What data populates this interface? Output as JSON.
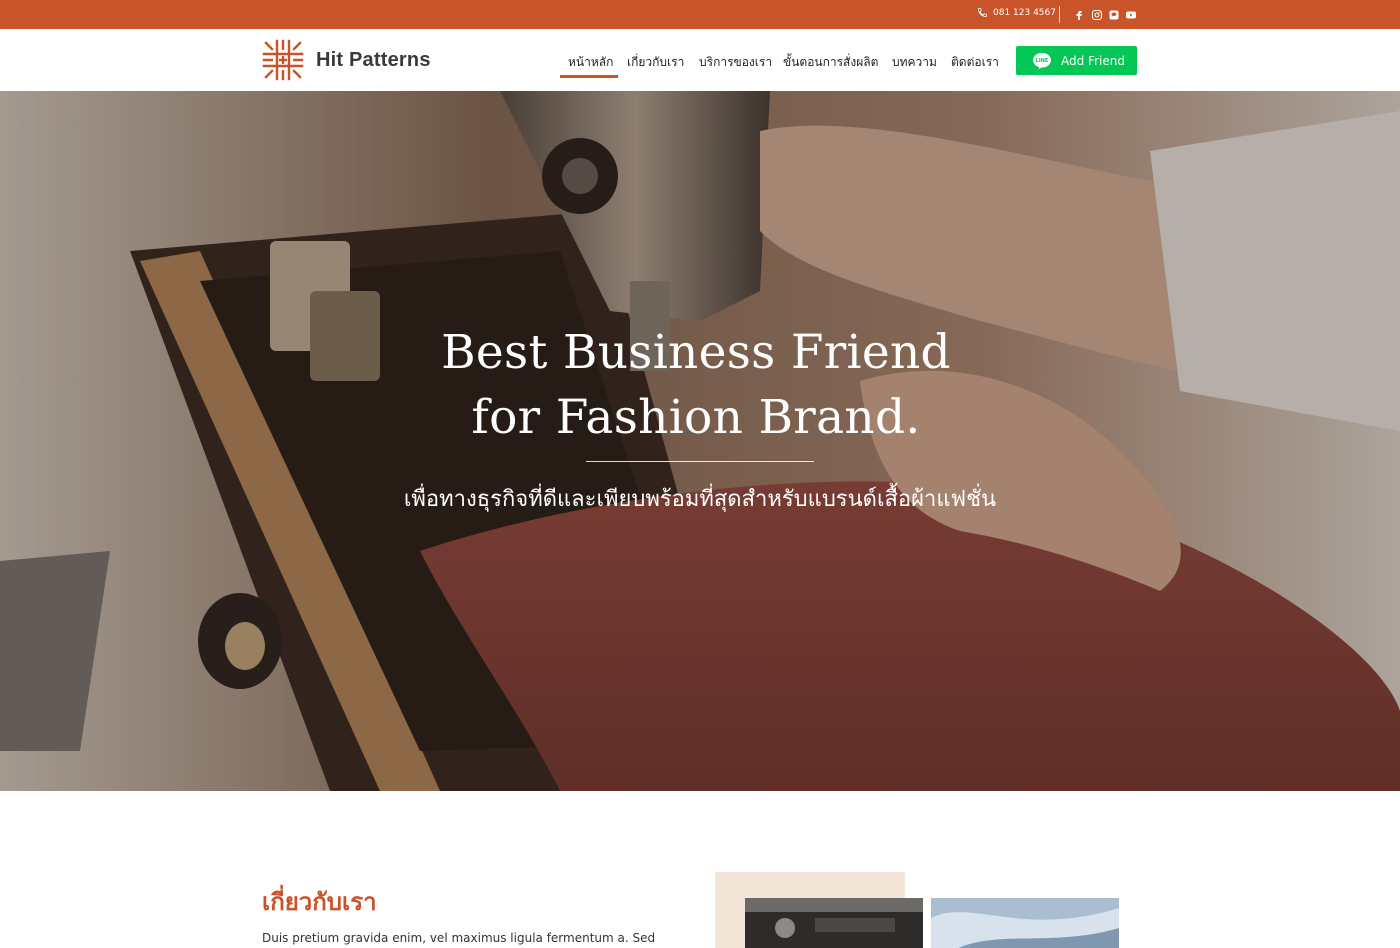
{
  "topbar": {
    "phone": "081 123 4567",
    "social_icons": [
      "facebook-icon",
      "instagram-icon",
      "line-icon",
      "youtube-icon"
    ]
  },
  "header": {
    "brand_name": "Hit Patterns",
    "nav": [
      {
        "label": "หน้าหลัก",
        "active": true
      },
      {
        "label": "เกี่ยวกับเรา"
      },
      {
        "label": "บริการของเรา"
      },
      {
        "label": "ขั้นตอนการสั่งผลิต"
      },
      {
        "label": "บทความ"
      },
      {
        "label": "ติดต่อเรา"
      }
    ],
    "add_friend_label": "Add Friend"
  },
  "hero": {
    "title_line1": "Best Business Friend",
    "title_line2": "for Fashion Brand.",
    "subtitle": "เพื่อทางธุรกิจที่ดีและเพียบพร้อมที่สุดสำหรับแบรนด์เสื้อผ้าแฟชั่น"
  },
  "about": {
    "title": "เกี่ยวกับเรา",
    "text": "Duis pretium gravida enim, vel maximus ligula fermentum a. Sed"
  },
  "colors": {
    "brand_orange": "#c9542a",
    "line_green": "#06c755"
  }
}
